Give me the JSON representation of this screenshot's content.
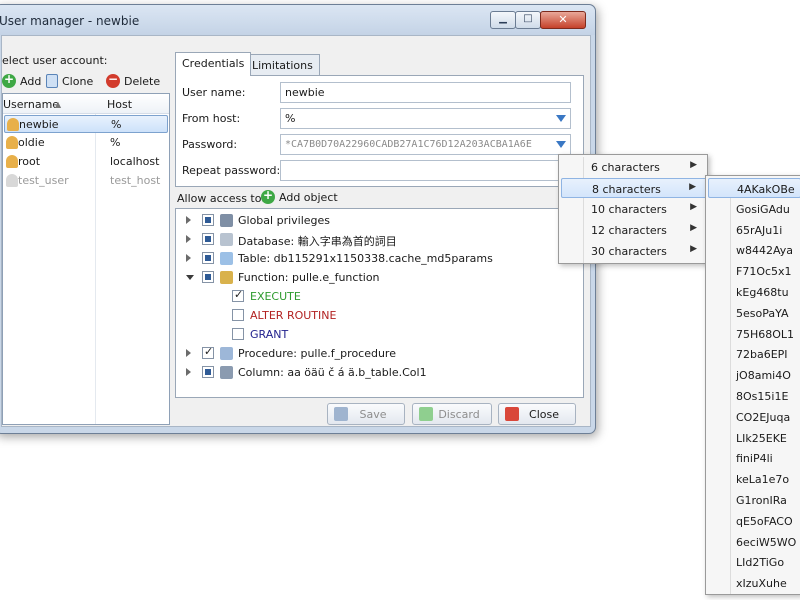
{
  "window": {
    "title": "User manager - newbie",
    "min_glyph": "▁",
    "max_glyph": "□",
    "close_glyph": "✕"
  },
  "left": {
    "select_label": "elect user account:",
    "toolbar": {
      "add": "Add",
      "clone": "Clone",
      "delete": "Delete"
    },
    "columns": {
      "username": "Username",
      "host": "Host"
    },
    "users": [
      {
        "name": "newbie",
        "host": "%",
        "selected": true,
        "disabled": false
      },
      {
        "name": "oldie",
        "host": "%",
        "selected": false,
        "disabled": false
      },
      {
        "name": "root",
        "host": "localhost",
        "selected": false,
        "disabled": false
      },
      {
        "name": "test_user",
        "host": "test_host",
        "selected": false,
        "disabled": true
      }
    ]
  },
  "tabs": {
    "credentials": "Credentials",
    "limitations": "Limitations"
  },
  "credentials": {
    "username_label": "User name:",
    "username_value": "newbie",
    "fromhost_label": "From host:",
    "fromhost_value": "%",
    "password_label": "Password:",
    "password_value": "*CA7B0D70A22960CADB27A1C76D12A203ACBA1A6E",
    "repeat_label": "Repeat password:",
    "repeat_value": ""
  },
  "access": {
    "label": "Allow access to:",
    "add_object": "Add object",
    "tree": [
      {
        "label": "Global privileges",
        "level": 0,
        "expander": "closed",
        "check": "partial",
        "icon": "globe-icon",
        "color": "#1a1a1a"
      },
      {
        "label": "Database: 輸入字串為首的詞目",
        "level": 0,
        "expander": "closed",
        "check": "partial",
        "icon": "database-icon",
        "color": "#1a1a1a"
      },
      {
        "label": "Table: db115291x1150338.cache_md5params",
        "level": 0,
        "expander": "closed",
        "check": "partial",
        "icon": "table-icon",
        "color": "#1a1a1a"
      },
      {
        "label": "Function: pulle.e_function",
        "level": 0,
        "expander": "open",
        "check": "partial",
        "icon": "function-icon",
        "color": "#1a1a1a"
      },
      {
        "label": "EXECUTE",
        "level": 1,
        "expander": "none",
        "check": "checked",
        "icon": "",
        "color": "#2e9b2e"
      },
      {
        "label": "ALTER ROUTINE",
        "level": 1,
        "expander": "none",
        "check": "unchecked",
        "icon": "",
        "color": "#b22222"
      },
      {
        "label": "GRANT",
        "level": 1,
        "expander": "none",
        "check": "unchecked",
        "icon": "",
        "color": "#23238e"
      },
      {
        "label": "Procedure: pulle.f_procedure",
        "level": 0,
        "expander": "closed",
        "check": "checked",
        "icon": "procedure-icon",
        "color": "#1a1a1a"
      },
      {
        "label": "Column: aa öäü č á ä.b_table.Col1",
        "level": 0,
        "expander": "closed",
        "check": "partial",
        "icon": "column-icon",
        "color": "#1a1a1a"
      }
    ]
  },
  "buttons": {
    "save": "Save",
    "discard": "Discard",
    "close": "Close"
  },
  "password_menu": {
    "items": [
      {
        "label": "6 characters",
        "arrow": "▶",
        "highlight": false
      },
      {
        "label": "8 characters",
        "arrow": "▶",
        "highlight": true
      },
      {
        "label": "10 characters",
        "arrow": "▶",
        "highlight": false
      },
      {
        "label": "12 characters",
        "arrow": "▶",
        "highlight": false
      },
      {
        "label": "30 characters",
        "arrow": "▶",
        "highlight": false
      }
    ]
  },
  "password_suggestions": [
    "4AKakOBe",
    "GosiGAdu",
    "65rAJu1i",
    "w8442Aya",
    "F71Oc5x1",
    "kEg468tu",
    "5esoPaYA",
    "75H68OL1",
    "72ba6EPI",
    "jO8ami4O",
    "8Os15i1E",
    "CO2EJuqa",
    "LIk25EKE",
    "finiP4li",
    "keLa1e7o",
    "G1ronIRa",
    "qE5oFACO",
    "6eciW5WO",
    "LId2TiGo",
    "xIzuXuhe"
  ]
}
